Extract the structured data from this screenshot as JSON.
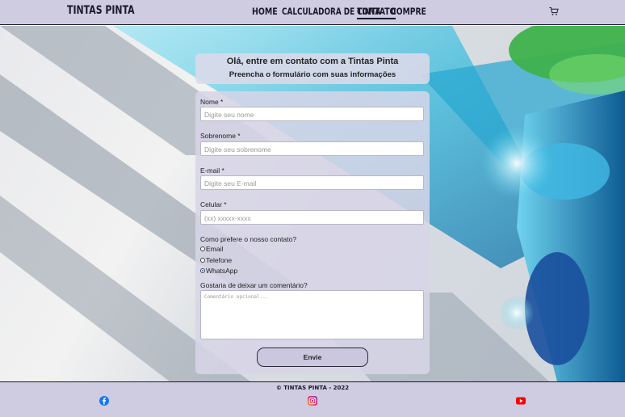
{
  "header": {
    "brand": "TINTAS PINTA",
    "nav": [
      {
        "label": "HOME",
        "active": false
      },
      {
        "label": "CALCULADORA DE TINTA",
        "active": false
      },
      {
        "label": "CONTATO",
        "active": true
      },
      {
        "label": "COMPRE",
        "active": false
      }
    ],
    "cart_icon": "cart-icon"
  },
  "form": {
    "title": "Olá, entre em contato com a Tintas Pinta",
    "subtitle": "Preencha o formulário com suas informações",
    "fields": [
      {
        "label": "Nome *",
        "placeholder": "Digite seu nome"
      },
      {
        "label": "Sobrenome *",
        "placeholder": "Digite seu sobrenome"
      },
      {
        "label": "E-mail *",
        "placeholder": "Digite seu E-mail"
      },
      {
        "label": "Celular *",
        "placeholder": "(xx) xxxxx-xxxx"
      }
    ],
    "contact_question": "Como prefere o nosso contato?",
    "contact_options": [
      {
        "label": "Email",
        "checked": false
      },
      {
        "label": "Telefone",
        "checked": false
      },
      {
        "label": "WhatsApp",
        "checked": true
      }
    ],
    "comment_label": "Gostaria de deixar um comentário?",
    "comment_placeholder": "Comentário opcional...",
    "submit_label": "Envie"
  },
  "footer": {
    "copyright": "© TINTAS PINTA - 2022",
    "social": [
      "facebook-icon",
      "instagram-icon",
      "youtube-icon"
    ]
  },
  "colors": {
    "header_bg": "#cfcbe0",
    "accent_blue": "#1aa6d8",
    "accent_green": "#37b34a"
  }
}
